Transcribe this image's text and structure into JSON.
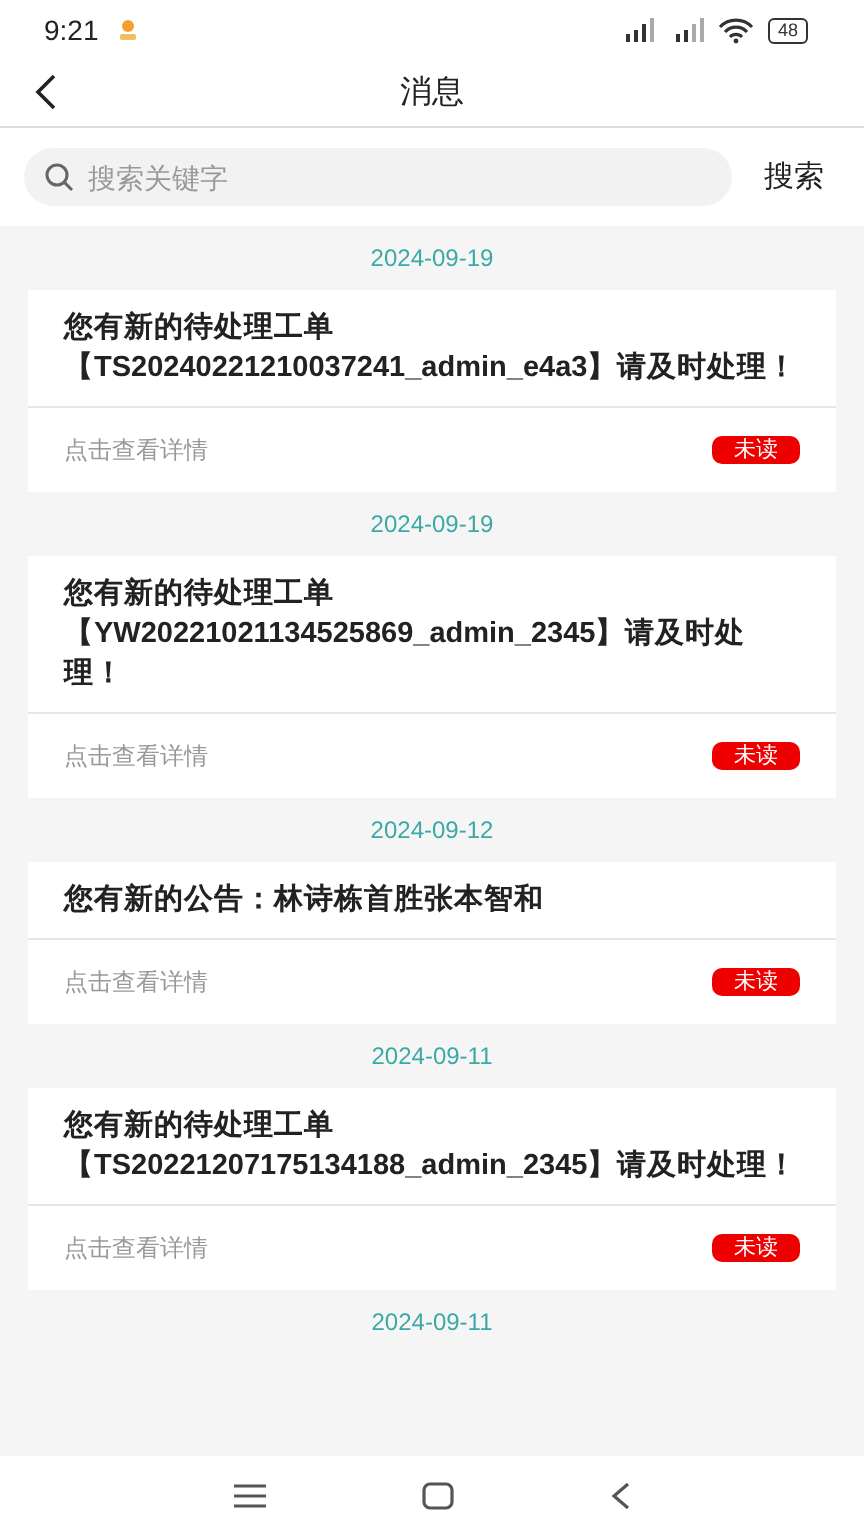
{
  "status_bar": {
    "time": "9:21",
    "battery": "48"
  },
  "header": {
    "title": "消息"
  },
  "search": {
    "placeholder": "搜索关键字",
    "button": "搜索"
  },
  "messages": [
    {
      "date": "2024-09-19",
      "text": "您有新的待处理工单【TS20240221210037241_admin_e4a3】请及时处理！",
      "link": "点击查看详情",
      "badge": "未读",
      "unread": true
    },
    {
      "date": "2024-09-19",
      "text": "您有新的待处理工单【YW20221021134525869_admin_2345】请及时处理！",
      "link": "点击查看详情",
      "badge": "未读",
      "unread": true
    },
    {
      "date": "2024-09-12",
      "text": "您有新的公告：林诗栋首胜张本智和",
      "link": "点击查看详情",
      "badge": "未读",
      "unread": true
    },
    {
      "date": "2024-09-11",
      "text": "您有新的待处理工单【TS20221207175134188_admin_2345】请及时处理！",
      "link": "点击查看详情",
      "badge": "未读",
      "unread": true
    },
    {
      "date": "2024-09-11"
    }
  ]
}
